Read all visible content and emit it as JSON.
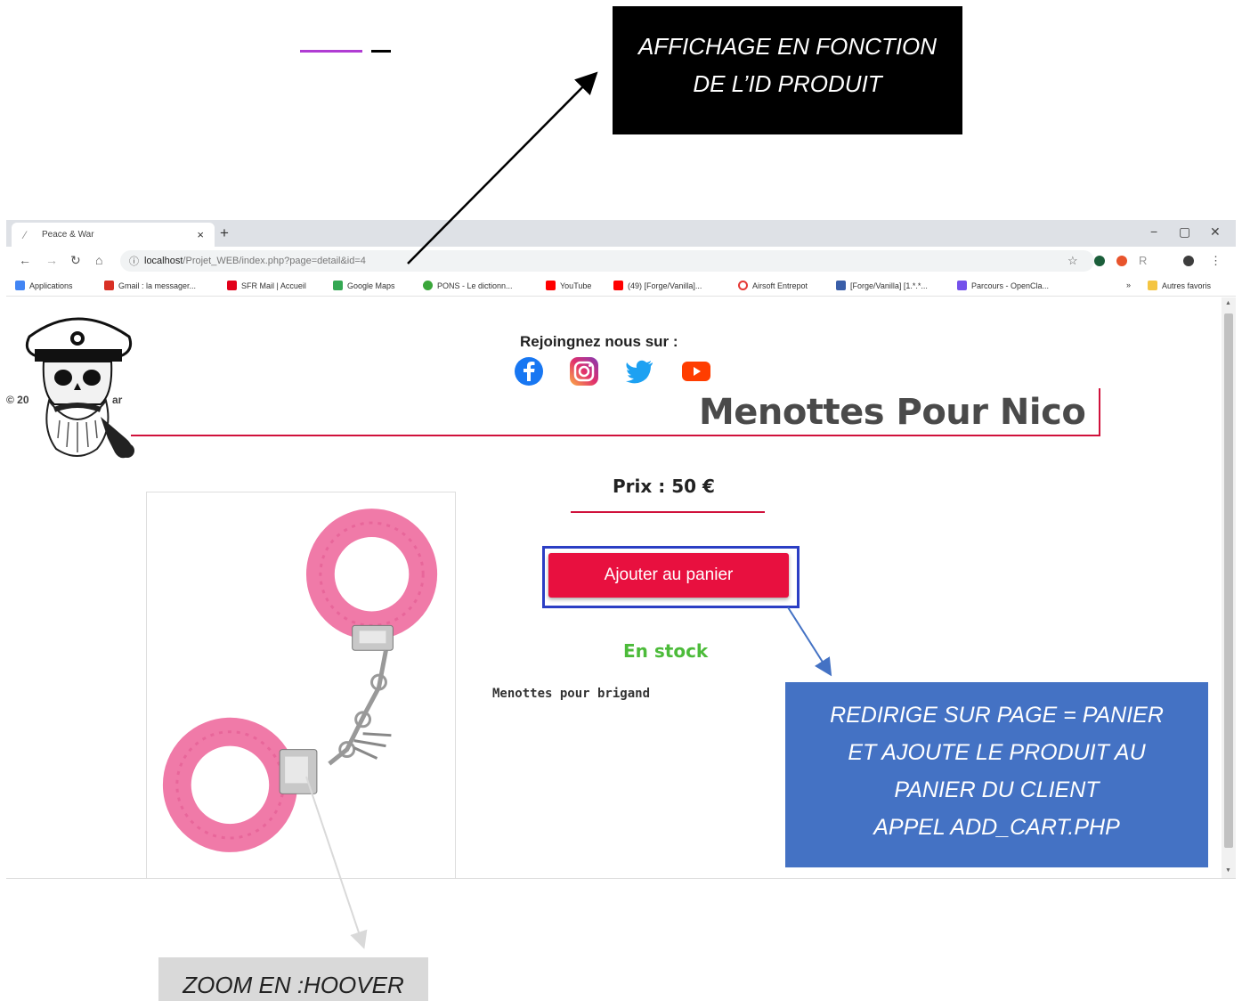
{
  "annotations": {
    "id_display": [
      "AFFICHAGE EN FONCTION",
      "DE L’ID PRODUIT"
    ],
    "add_cart": [
      "REDIRIGE SUR PAGE = PANIER",
      "ET AJOUTE LE PRODUIT AU",
      "PANIER DU CLIENT",
      "APPEL ADD_CART.PHP"
    ],
    "zoom": "ZOOM EN :HOOVER"
  },
  "browser": {
    "tab_title": "Peace & War",
    "url_host": "localhost",
    "url_path": "/Projet_WEB/index.php?page=detail&id=4",
    "bookmarks": [
      {
        "label": "Applications",
        "icon": "apps-grid-icon",
        "color": "#4285f4"
      },
      {
        "label": "Gmail : la messager...",
        "icon": "gmail-icon",
        "color": "#d93025"
      },
      {
        "label": "SFR Mail | Accueil",
        "icon": "sfr-icon",
        "color": "#e2001a"
      },
      {
        "label": "Google Maps",
        "icon": "maps-icon",
        "color": "#34a853"
      },
      {
        "label": "PONS - Le dictionn...",
        "icon": "pons-icon",
        "color": "#3aa63a"
      },
      {
        "label": "YouTube",
        "icon": "youtube-icon",
        "color": "#ff0000"
      },
      {
        "label": "(49) [Forge/Vanilla]...",
        "icon": "youtube-icon",
        "color": "#ff0000"
      },
      {
        "label": "Airsoft Entrepot",
        "icon": "target-icon",
        "color": "#e53935"
      },
      {
        "label": "[Forge/Vanilla] [1.*.*...",
        "icon": "forge-icon",
        "color": "#3a5ea8"
      },
      {
        "label": "Parcours - OpenCla...",
        "icon": "openclassrooms-icon",
        "color": "#7451eb"
      },
      {
        "label": "Autres favoris",
        "icon": "folder-icon",
        "color": "#f4c542"
      }
    ],
    "more_bookmarks": "»"
  },
  "site": {
    "copyright_head": "© 20",
    "copyright_tail": "ar",
    "join_title": "Rejoingnez nous sur :",
    "social": [
      "facebook-icon",
      "instagram-icon",
      "twitter-icon",
      "youtube-icon"
    ]
  },
  "product": {
    "title": "Menottes Pour Nico",
    "price": "Prix : 50 €",
    "add_button": "Ajouter au panier",
    "stock": "En stock",
    "description": "Menottes pour brigand"
  },
  "colors": {
    "accent": "#d0113b",
    "button": "#e8103f",
    "stock": "#4cbb3a",
    "annotation_blue": "#4472c4",
    "frame_blue": "#2b3ec4"
  }
}
